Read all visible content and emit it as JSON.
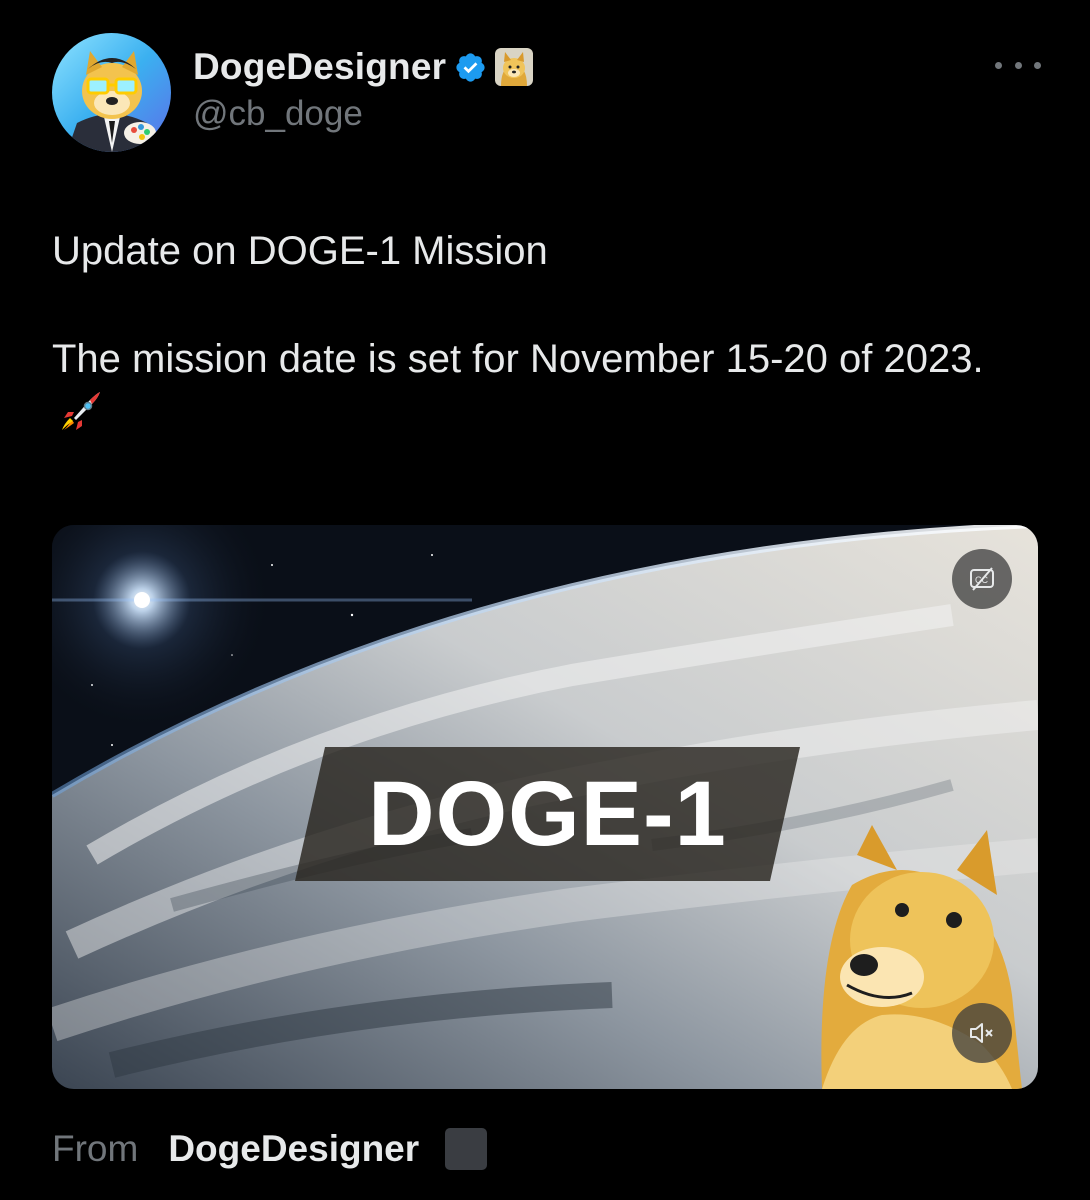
{
  "author": {
    "display_name": "DogeDesigner",
    "handle": "@cb_doge",
    "avatar_icon": "doge-avatar-icon",
    "verified_color": "#1d9bf0"
  },
  "more_icon": "more-horizontal-icon",
  "text": {
    "line1": "Update on DOGE-1 Mission",
    "line2": "The mission date is set for November 15-20 of 2023.",
    "emoji_icon": "rocket-icon"
  },
  "media": {
    "title": "DOGE-1",
    "cc_icon": "captions-off-icon",
    "mute_icon": "muted-speaker-icon"
  },
  "source": {
    "prefix": "From",
    "name": "DogeDesigner"
  },
  "colors": {
    "background": "#000000",
    "text_primary": "#e7e9ea",
    "text_secondary": "#71767b"
  }
}
